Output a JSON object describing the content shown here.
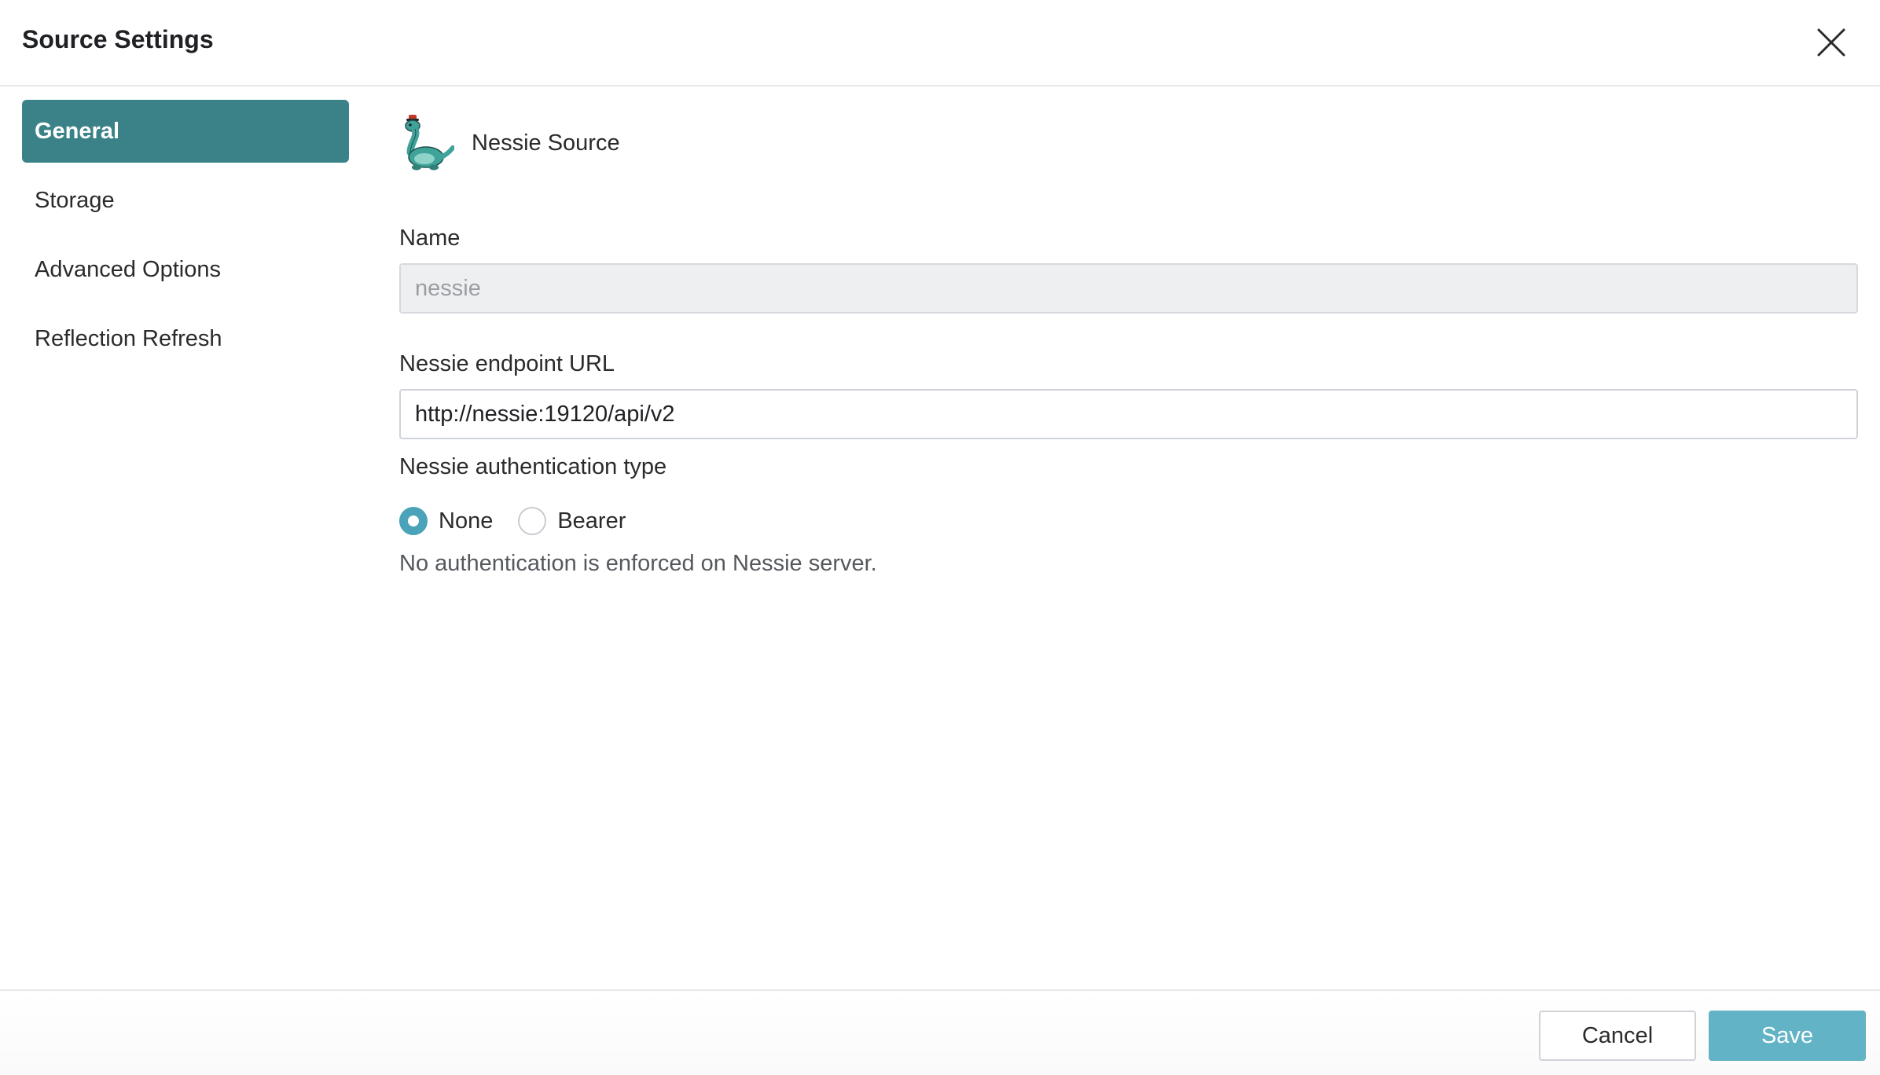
{
  "dialog": {
    "title": "Source Settings",
    "close_icon": "close-icon"
  },
  "sidebar": {
    "items": [
      {
        "label": "General",
        "active": true
      },
      {
        "label": "Storage",
        "active": false
      },
      {
        "label": "Advanced Options",
        "active": false
      },
      {
        "label": "Reflection Refresh",
        "active": false
      }
    ]
  },
  "source": {
    "icon": "nessie-icon",
    "name": "Nessie Source"
  },
  "form": {
    "name_label": "Name",
    "name_value": "nessie",
    "endpoint_label": "Nessie endpoint URL",
    "endpoint_value": "http://nessie:19120/api/v2",
    "auth_label": "Nessie authentication type",
    "auth_options": [
      {
        "label": "None",
        "selected": true
      },
      {
        "label": "Bearer",
        "selected": false
      }
    ],
    "auth_help": "No authentication is enforced on Nessie server."
  },
  "footer": {
    "cancel_label": "Cancel",
    "save_label": "Save"
  },
  "colors": {
    "active_nav": "#3a8287",
    "save_button": "#62b3c6",
    "radio_accent": "#4aa3b8"
  }
}
